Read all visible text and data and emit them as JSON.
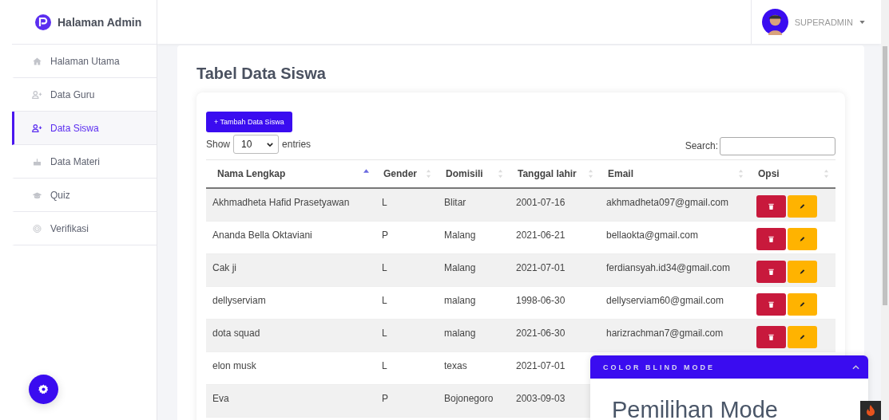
{
  "sidebar": {
    "brand": "Halaman Admin",
    "items": [
      {
        "label": "Halaman Utama",
        "selected": false
      },
      {
        "label": "Data Guru",
        "selected": false
      },
      {
        "label": "Data Siswa",
        "selected": true
      },
      {
        "label": "Data Materi",
        "selected": false
      },
      {
        "label": "Quiz",
        "selected": false
      },
      {
        "label": "Verifikasi",
        "selected": false
      }
    ]
  },
  "topbar": {
    "user": "SUPERADMIN"
  },
  "page": {
    "title": "Tabel Data Siswa",
    "add_button": "+ Tambah Data Siswa",
    "show_label": "Show",
    "entries_value": "10",
    "entries_label": "entries",
    "search_label": "Search:"
  },
  "table": {
    "columns": [
      {
        "label": "Nama Lengkap",
        "sorted": true
      },
      {
        "label": "Gender",
        "sorted": false
      },
      {
        "label": "Domisili",
        "sorted": false
      },
      {
        "label": "Tanggal lahir",
        "sorted": false
      },
      {
        "label": "Email",
        "sorted": false
      },
      {
        "label": "Opsi",
        "sorted": false
      }
    ],
    "rows": [
      {
        "name": "Akhmadheta Hafid Prasetyawan",
        "gender": "L",
        "domisili": "Blitar",
        "tanggal": "2001-07-16",
        "email": "akhmadheta097@gmail.com"
      },
      {
        "name": "Ananda Bella Oktaviani",
        "gender": "P",
        "domisili": "Malang",
        "tanggal": "2021-06-21",
        "email": "bellaokta@gmail.com"
      },
      {
        "name": "Cak ji",
        "gender": "L",
        "domisili": "Malang",
        "tanggal": "2021-07-01",
        "email": "ferdiansyah.id34@gmail.com"
      },
      {
        "name": "dellyserviam",
        "gender": "L",
        "domisili": "malang",
        "tanggal": "1998-06-30",
        "email": "dellyserviam60@gmail.com"
      },
      {
        "name": "dota squad",
        "gender": "L",
        "domisili": "malang",
        "tanggal": "2021-06-30",
        "email": "harizrachman7@gmail.com"
      },
      {
        "name": "elon musk",
        "gender": "L",
        "domisili": "texas",
        "tanggal": "2021-07-01"
      },
      {
        "name": "Eva",
        "gender": "P",
        "domisili": "Bojonegoro",
        "tanggal": "2003-09-03"
      }
    ]
  },
  "color_blind_panel": {
    "title": "COLOR BLIND MODE",
    "heading": "Pemilihan Mode",
    "expanded": true
  }
}
